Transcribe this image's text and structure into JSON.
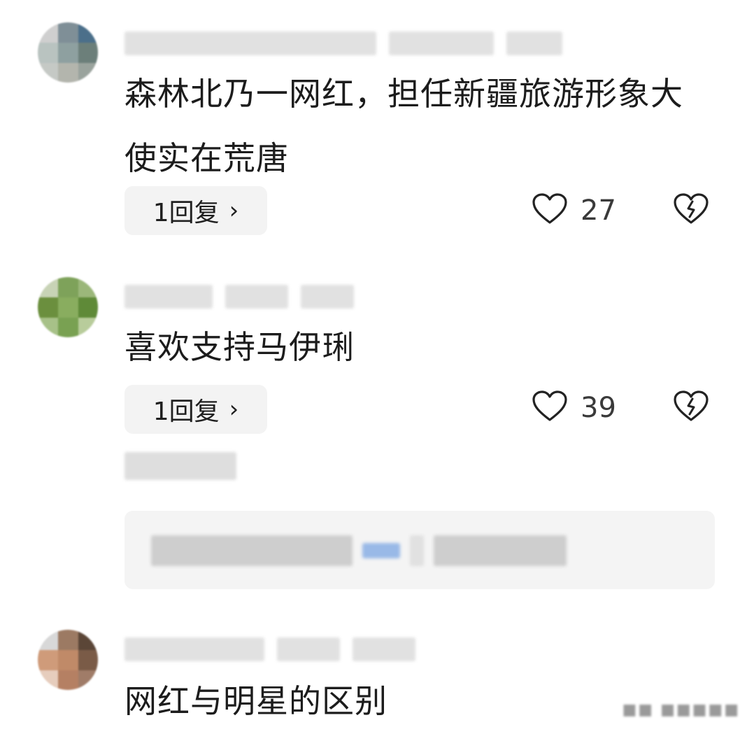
{
  "comments": [
    {
      "text": "森林北乃一网红，担任新疆旅游形象大使实在荒唐",
      "reply_label": "1回复",
      "likes": "27",
      "avatar_colors": [
        "#cfcfcf",
        "#7f8f97",
        "#4b6f8a",
        "#b9c3c0",
        "#8ea0a0",
        "#6c7f7a",
        "#c5c9c5",
        "#b3b5ad",
        "#9aa39d"
      ]
    },
    {
      "text": "喜欢支持马伊琍",
      "reply_label": "1回复",
      "likes": "39",
      "avatar_colors": [
        "#c8d3b6",
        "#7ea25a",
        "#9bb77a",
        "#6b8f3e",
        "#89ad5f",
        "#5f8a38",
        "#a7c188",
        "#79a152",
        "#b8cc9b"
      ]
    },
    {
      "text": "网红与明星的区别",
      "avatar_colors": [
        "#d8d8d8",
        "#9c7a63",
        "#5b4637",
        "#cf9b7a",
        "#c08a68",
        "#7a5b47",
        "#e6cdbd",
        "#b58063",
        "#a07c68"
      ]
    }
  ],
  "icons": {
    "heart": "heart-outline-icon",
    "broken_heart": "broken-heart-icon",
    "chevron": "chevron-right-icon"
  },
  "colors": {
    "button_bg": "#f3f3f3",
    "subreply_bg": "#f4f4f4",
    "icon_stroke": "#222222"
  },
  "ui": {
    "chevron": "›"
  }
}
